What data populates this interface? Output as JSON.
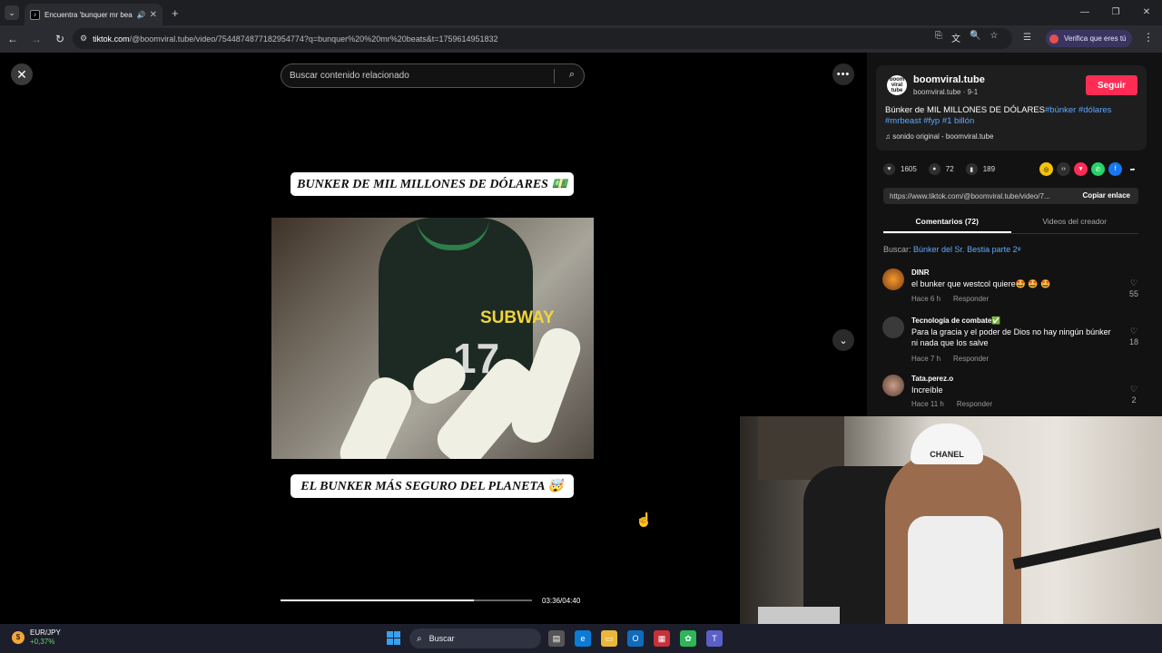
{
  "browser": {
    "tab_title": "Encuentra 'bunquer mr bea",
    "url_host": "tiktok.com",
    "url_path": "/@boomviral.tube/video/7544874877182954774?q=bunquer%20%20mr%20beats&t=1759614951832",
    "verify_label": "Verifica que eres tú"
  },
  "video": {
    "search_placeholder": "Buscar contenido relacionado",
    "caption_top": "BUNKER DE MIL MILLONES DE DÓLARES 💵",
    "caption_bottom": "EL BUNKER MÁS SEGURO DEL PLANETA 🤯",
    "shirt_logo": "SUBWAY",
    "shirt_number": "17",
    "time": "03:36/04:40",
    "progress": 0.77
  },
  "author": {
    "avatar_text": "boom viral tube",
    "name": "boomviral.tube",
    "sub": "boomviral.tube · 9-1",
    "follow_label": "Seguir",
    "desc_text": "Búnker de MIL MILLONES DE DÓLARES",
    "desc_tags": "#búnker #dólares #mrbeast #fyp #1 billón",
    "music": "sonido original - boomviral.tube"
  },
  "stats": {
    "likes": "1605",
    "comments": "72",
    "saves": "189"
  },
  "link": {
    "url": "https://www.tiktok.com/@boomviral.tube/video/7...",
    "copy_label": "Copiar enlace"
  },
  "tabs": {
    "comments": "Comentarios (72)",
    "creator_videos": "Videos del creador"
  },
  "search_suggestion": {
    "prefix": "Buscar:",
    "query": "Búnker del Sr. Bestia parte 2"
  },
  "comments": [
    {
      "user": "DINR",
      "text": "el bunker que westcol quiere🤩 🤩 🤩",
      "time": "Hace 6 h",
      "reply": "Responder",
      "likes": "55"
    },
    {
      "user": "Tecnología de combate✅",
      "text": "Para la gracia y el poder de Dios no hay ningún búnker ni nada que los salve",
      "time": "Hace 7 h",
      "reply": "Responder",
      "likes": "18"
    },
    {
      "user": "Tata.perez.o",
      "text": "Increíble",
      "time": "Hace 11 h",
      "reply": "Responder",
      "likes": "2"
    }
  ],
  "webcam": {
    "cap_text": "CHANEL"
  },
  "taskbar": {
    "fx_pair": "EUR/JPY",
    "fx_change": "+0,37%",
    "search_label": "Buscar"
  },
  "colors": {
    "follow": "#fe2c55",
    "hashtag": "#5ea8ff",
    "page_bg": "#000000",
    "panel_bg": "#121212"
  }
}
